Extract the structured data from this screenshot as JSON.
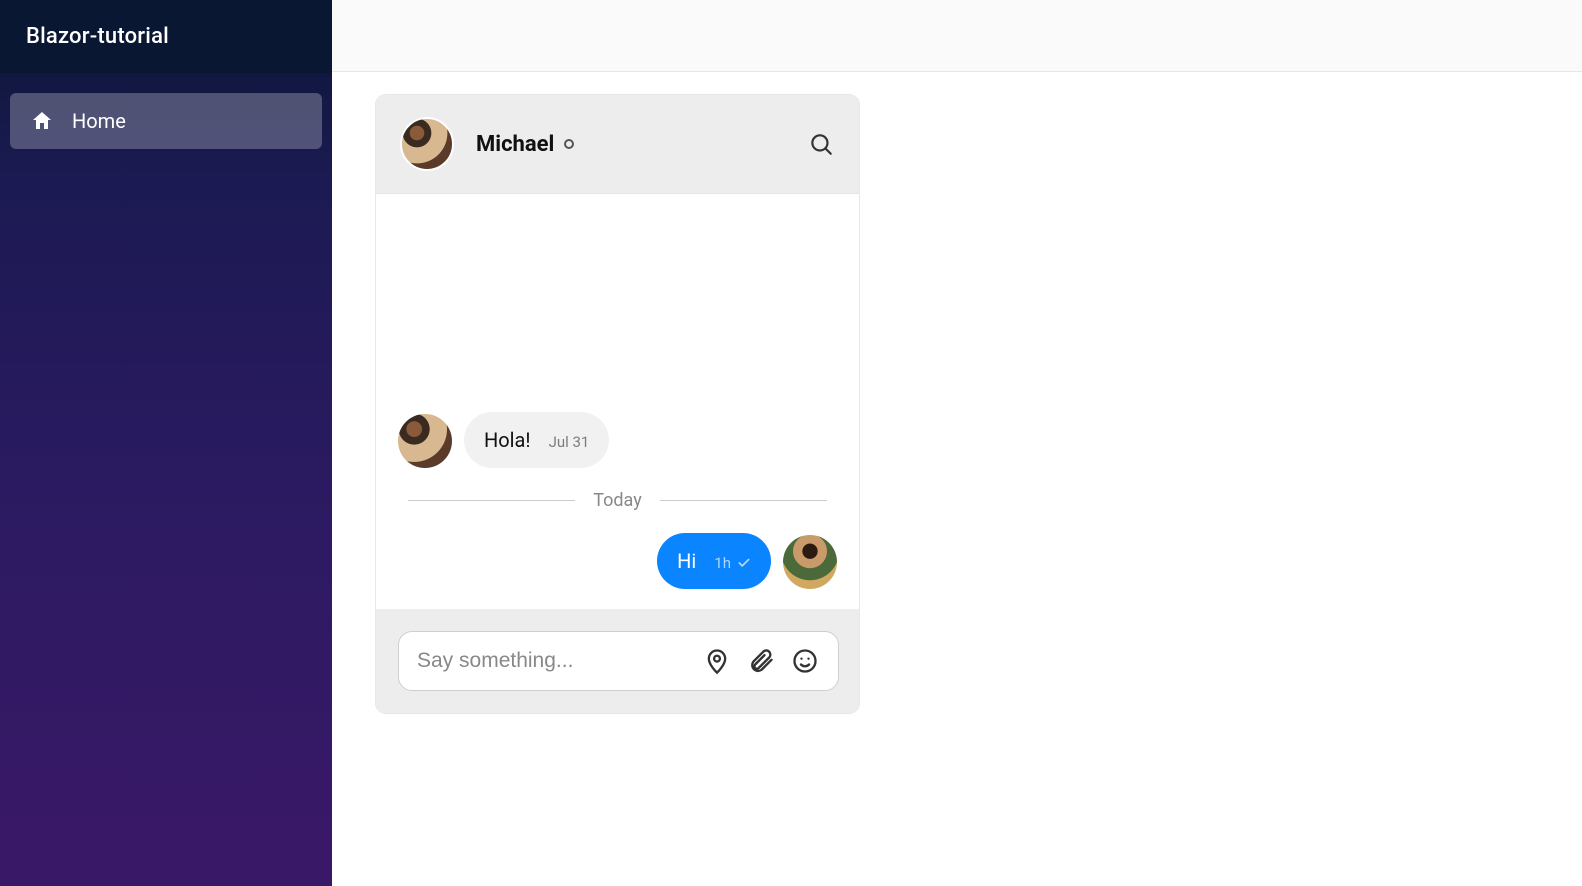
{
  "app": {
    "title": "Blazor-tutorial"
  },
  "sidebar": {
    "items": [
      {
        "label": "Home",
        "icon": "home-icon"
      }
    ]
  },
  "chat": {
    "contact": {
      "name": "Michael",
      "status": "offline"
    },
    "divider_label": "Today",
    "messages": {
      "incoming": [
        {
          "text": "Hola!",
          "timestamp": "Jul 31"
        }
      ],
      "outgoing": [
        {
          "text": "Hi",
          "timestamp": "1h",
          "delivered": true
        }
      ]
    },
    "compose": {
      "placeholder": "Say something..."
    }
  }
}
